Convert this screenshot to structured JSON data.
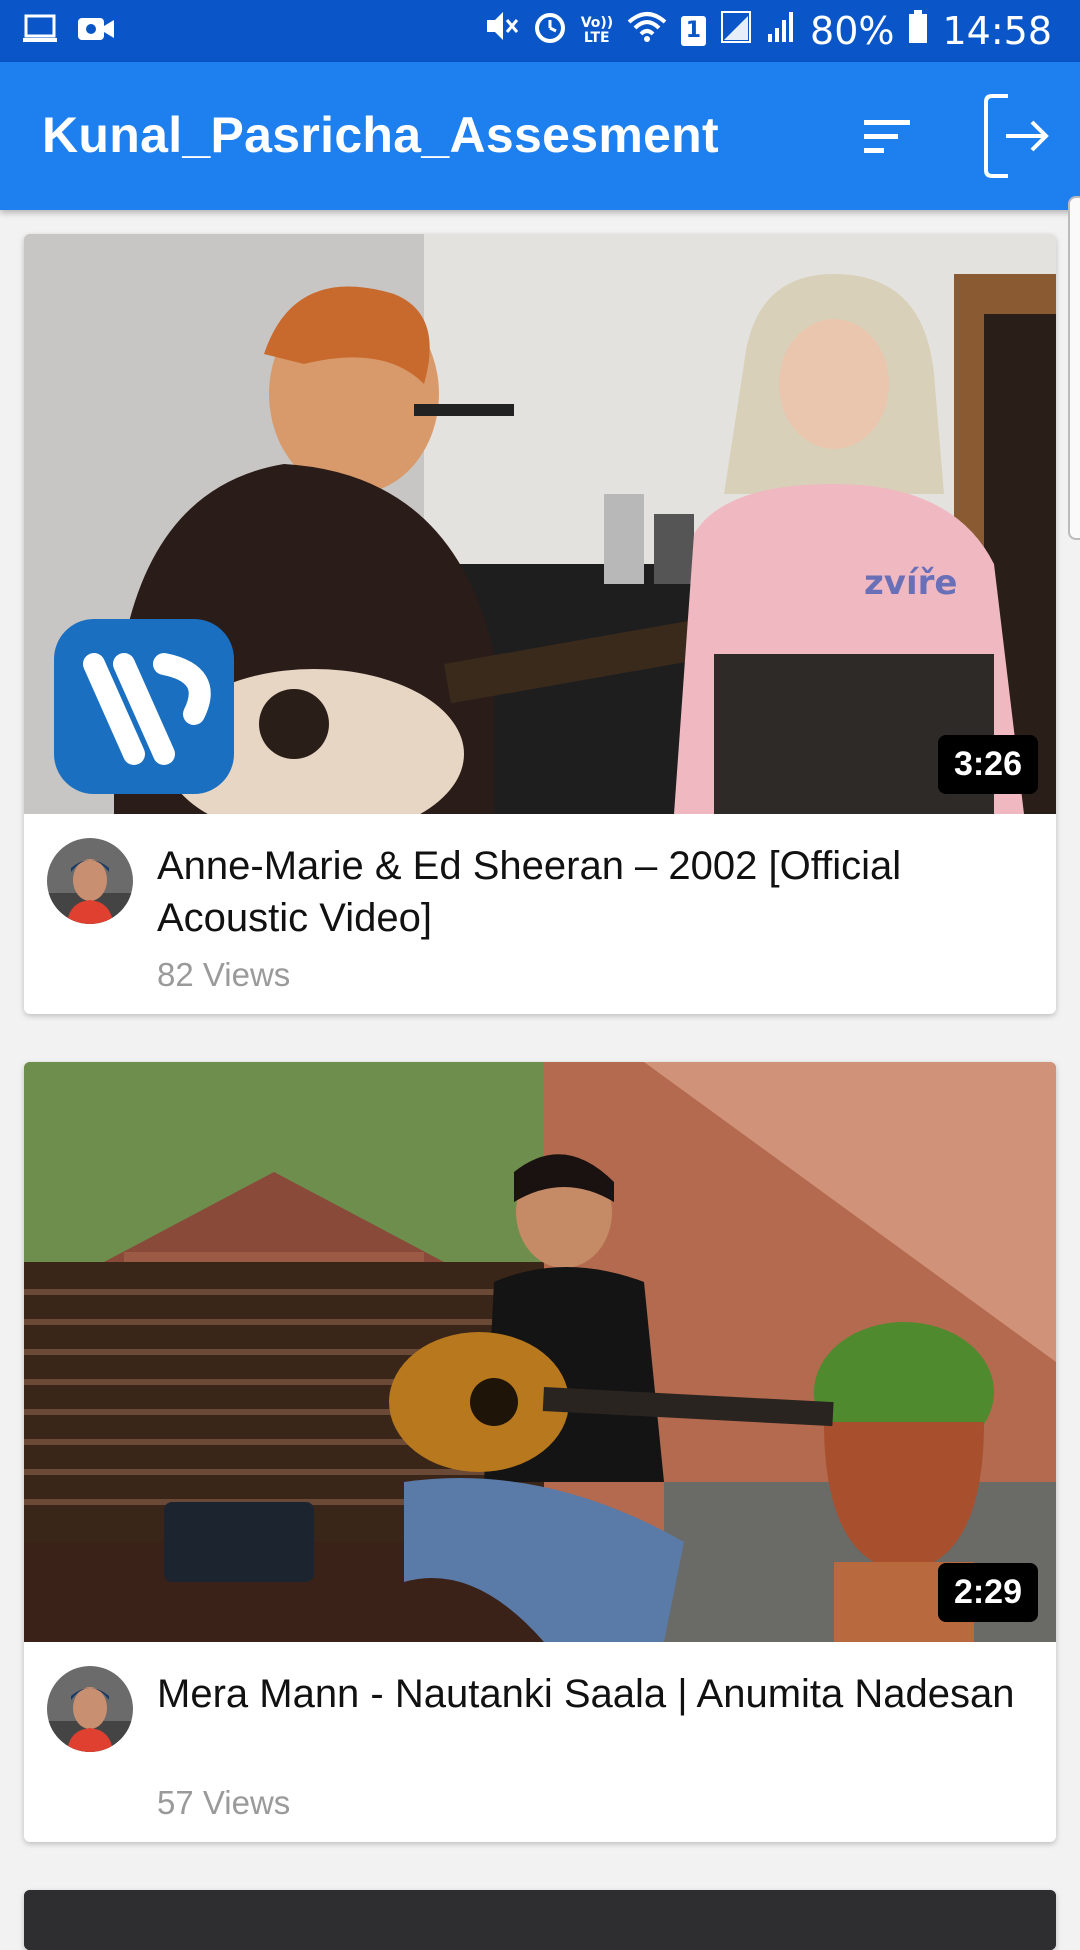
{
  "status_bar": {
    "left_icons": [
      "laptop-icon",
      "video-camera-icon"
    ],
    "right_icons": [
      "mute-icon",
      "alarm-icon",
      "volte-icon",
      "wifi-icon",
      "sim-1-icon",
      "signal-icon",
      "signal-icon"
    ],
    "volte_label": "Vo)) LTE",
    "sim_label": "1",
    "battery": "80%",
    "time": "14:58"
  },
  "app_bar": {
    "title": "Kunal_Pasricha_Assesment",
    "actions": [
      "sort-icon",
      "logout-icon"
    ]
  },
  "videos": [
    {
      "title": "Anne-Marie & Ed Sheeran – 2002 [Official Acoustic Video]",
      "views": "82 Views",
      "duration": "3:26",
      "thumbnail_text": "zvíře"
    },
    {
      "title": "Mera Mann - Nautanki Saala | Anumita Nadesan",
      "views": "57 Views",
      "duration": "2:29"
    }
  ],
  "colors": {
    "status_bar": "#0a56c8",
    "app_bar": "#1e7fef",
    "background": "#f2f2f2"
  }
}
